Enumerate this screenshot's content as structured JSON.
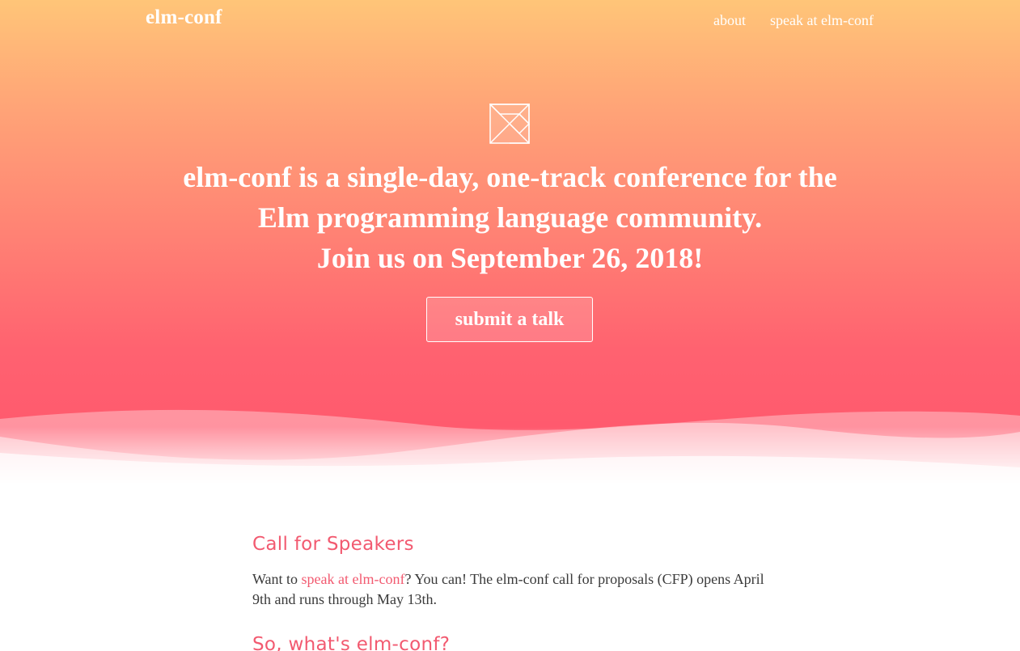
{
  "header": {
    "brand": "elm-conf",
    "nav": [
      {
        "label": "about"
      },
      {
        "label": "speak at elm-conf"
      }
    ]
  },
  "hero": {
    "logo_icon": "elm-tangram-icon",
    "headline_lines": [
      "elm-conf is a single-day, one-track conference for the",
      "Elm programming language community.",
      "Join us on September 26, 2018!"
    ],
    "cta_label": "submit a talk"
  },
  "sections": {
    "cfs_title": "Call for Speakers",
    "cfs_text_before": "Want to ",
    "cfs_link": "speak at elm-conf",
    "cfs_text_after": "? You can! The elm-conf call for proposals (CFP) opens April 9th and runs through May 13th.",
    "whats_title": "So, what's elm-conf?"
  },
  "colors": {
    "gradient_top": "#ffc578",
    "gradient_bottom": "#ff5a6e",
    "accent": "#f25a70",
    "body_text": "#3a3a3a"
  }
}
